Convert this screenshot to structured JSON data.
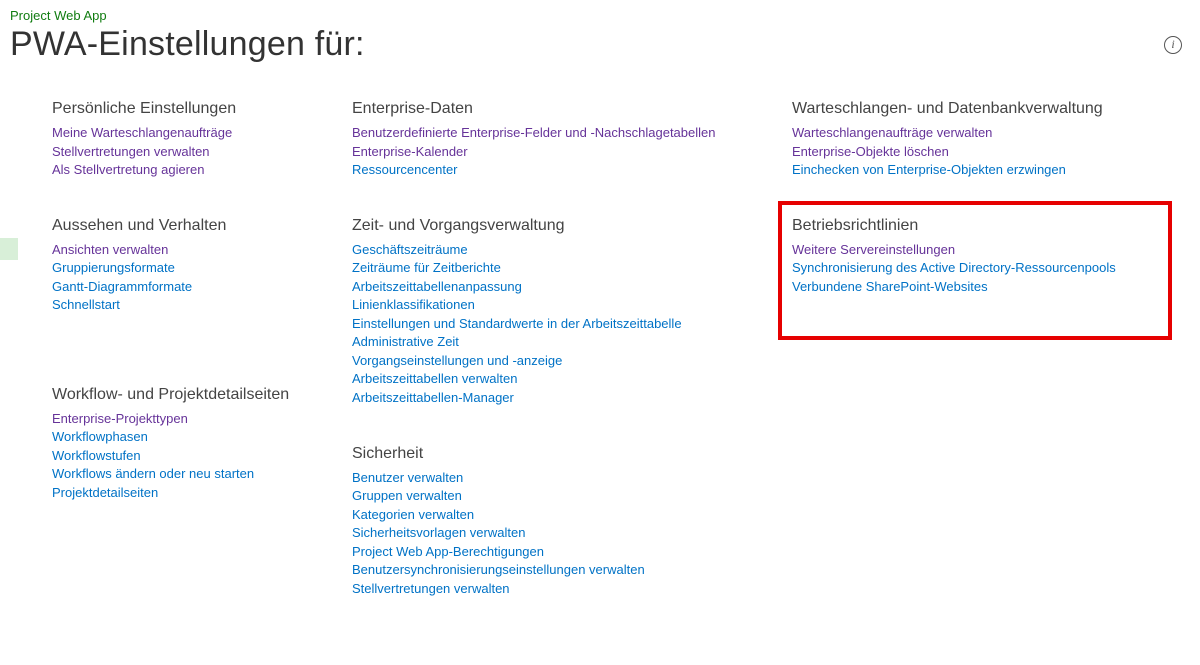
{
  "breadcrumb": "Project Web App",
  "page_title": "PWA-Einstellungen für:",
  "info_glyph": "i",
  "col1": {
    "s1": {
      "title": "Persönliche Einstellungen",
      "links": [
        {
          "t": "Meine Warteschlangenaufträge",
          "v": true
        },
        {
          "t": "Stellvertretungen verwalten",
          "v": true
        },
        {
          "t": "Als Stellvertretung agieren",
          "v": true
        }
      ]
    },
    "s2": {
      "title": "Aussehen und Verhalten",
      "links": [
        {
          "t": "Ansichten verwalten",
          "v": true
        },
        {
          "t": "Gruppierungsformate",
          "v": false
        },
        {
          "t": "Gantt-Diagrammformate",
          "v": false
        },
        {
          "t": "Schnellstart",
          "v": false
        }
      ]
    },
    "s3": {
      "title": "Workflow- und Projektdetailseiten",
      "links": [
        {
          "t": "Enterprise-Projekttypen",
          "v": true
        },
        {
          "t": "Workflowphasen",
          "v": false
        },
        {
          "t": "Workflowstufen",
          "v": false
        },
        {
          "t": "Workflows ändern oder neu starten",
          "v": false
        },
        {
          "t": "Projektdetailseiten",
          "v": false
        }
      ]
    }
  },
  "col2": {
    "s1": {
      "title": "Enterprise-Daten",
      "links": [
        {
          "t": "Benutzerdefinierte Enterprise-Felder und -Nachschlagetabellen",
          "v": true
        },
        {
          "t": "Enterprise-Kalender",
          "v": true
        },
        {
          "t": "Ressourcencenter",
          "v": false
        }
      ]
    },
    "s2": {
      "title": "Zeit- und Vorgangsverwaltung",
      "links": [
        {
          "t": "Geschäftszeiträume",
          "v": false
        },
        {
          "t": "Zeiträume für Zeitberichte",
          "v": false
        },
        {
          "t": "Arbeitszeittabellenanpassung",
          "v": false
        },
        {
          "t": "Linienklassifikationen",
          "v": false
        },
        {
          "t": "Einstellungen und Standardwerte in der Arbeitszeittabelle",
          "v": false
        },
        {
          "t": "Administrative Zeit",
          "v": false
        },
        {
          "t": "Vorgangseinstellungen und -anzeige",
          "v": false
        },
        {
          "t": "Arbeitszeittabellen verwalten",
          "v": false
        },
        {
          "t": "Arbeitszeittabellen-Manager",
          "v": false
        }
      ]
    },
    "s3": {
      "title": "Sicherheit",
      "links": [
        {
          "t": "Benutzer verwalten",
          "v": false
        },
        {
          "t": "Gruppen verwalten",
          "v": false
        },
        {
          "t": "Kategorien verwalten",
          "v": false
        },
        {
          "t": "Sicherheitsvorlagen verwalten",
          "v": false
        },
        {
          "t": "Project Web App-Berechtigungen",
          "v": false
        },
        {
          "t": "Benutzersynchronisierungseinstellungen verwalten",
          "v": false
        },
        {
          "t": "Stellvertretungen verwalten",
          "v": false
        }
      ]
    }
  },
  "col3": {
    "s1": {
      "title": "Warteschlangen- und Datenbankverwaltung",
      "links": [
        {
          "t": "Warteschlangenaufträge verwalten",
          "v": true
        },
        {
          "t": "Enterprise-Objekte löschen",
          "v": true
        },
        {
          "t": "Einchecken von Enterprise-Objekten erzwingen",
          "v": false
        }
      ]
    },
    "s2": {
      "title": "Betriebsrichtlinien",
      "links": [
        {
          "t": "Weitere Servereinstellungen",
          "v": true
        },
        {
          "t": "Synchronisierung des Active Directory-Ressourcenpools",
          "v": false
        },
        {
          "t": "Verbundene SharePoint-Websites",
          "v": false
        }
      ]
    }
  }
}
